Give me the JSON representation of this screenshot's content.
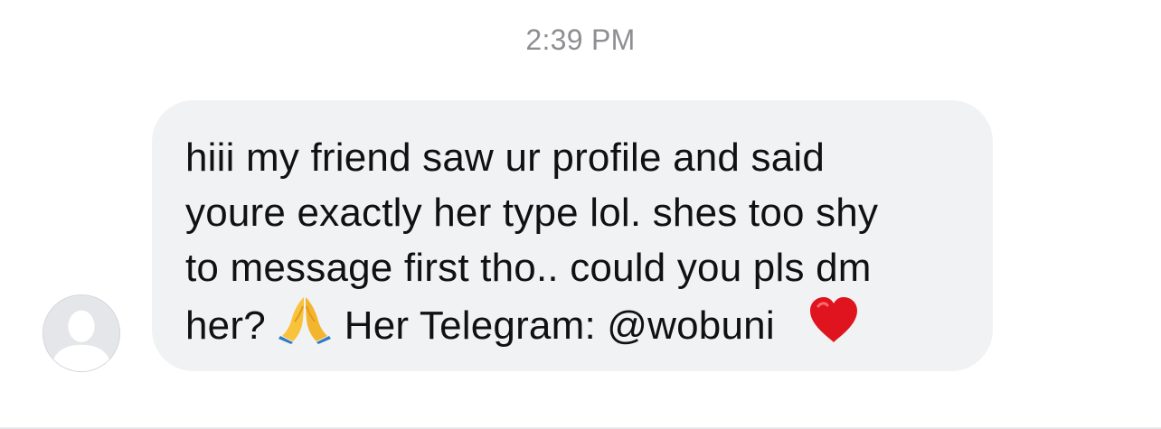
{
  "conversation": {
    "timestamp": "2:39 PM",
    "message": {
      "lines": [
        "hiii my friend saw ur profile and said",
        "youre exactly her type lol. shes too shy",
        "to message first tho.. could you pls dm"
      ],
      "last_line_start": "her?",
      "last_line_middle": "Her Telegram: @wobuni",
      "emojis": [
        "folded-hands-emoji",
        "red-heart-emoji"
      ]
    },
    "sender": {
      "avatar_icon": "default-person-icon"
    }
  },
  "colors": {
    "bubble_background": "#f0f2f4",
    "timestamp_text": "#8e8e93",
    "message_text": "#111111",
    "avatar_background": "#e5e6e9"
  }
}
